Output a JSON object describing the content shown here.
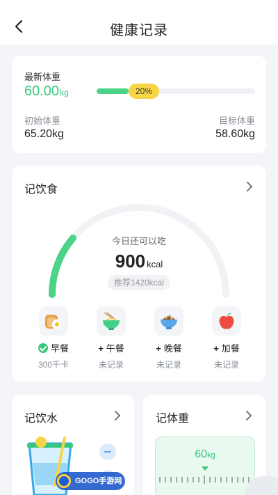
{
  "header": {
    "title": "健康记录"
  },
  "weight": {
    "latest_label": "最新体重",
    "latest_value": "60.00",
    "latest_unit": "kg",
    "progress_percent": 20,
    "progress_label": "20%",
    "initial_label": "初始体重",
    "initial_value": "65.20kg",
    "target_label": "目标体重",
    "target_value": "58.60kg"
  },
  "food": {
    "title": "记饮食",
    "today_label": "今日还可以吃",
    "remaining_value": "900",
    "remaining_unit": "kcal",
    "recommend": "推荐1420kcal",
    "meals": [
      {
        "name": "早餐",
        "status": "300千卡",
        "icon": "toast-egg-icon",
        "recorded": true
      },
      {
        "name": "午餐",
        "status": "未记录",
        "icon": "noodle-bowl-icon",
        "recorded": false
      },
      {
        "name": "晚餐",
        "status": "未记录",
        "icon": "rice-bowl-icon",
        "recorded": false
      },
      {
        "name": "加餐",
        "status": "未记录",
        "icon": "apple-icon",
        "recorded": false
      }
    ]
  },
  "water": {
    "title": "记饮水"
  },
  "body_weight": {
    "title": "记体重",
    "scale_value": "60",
    "scale_unit": "kg"
  },
  "watermark": {
    "text": "GOGO手游网"
  },
  "colors": {
    "accent": "#37c77a",
    "badge": "#f8d546",
    "track": "#eef0f3"
  }
}
